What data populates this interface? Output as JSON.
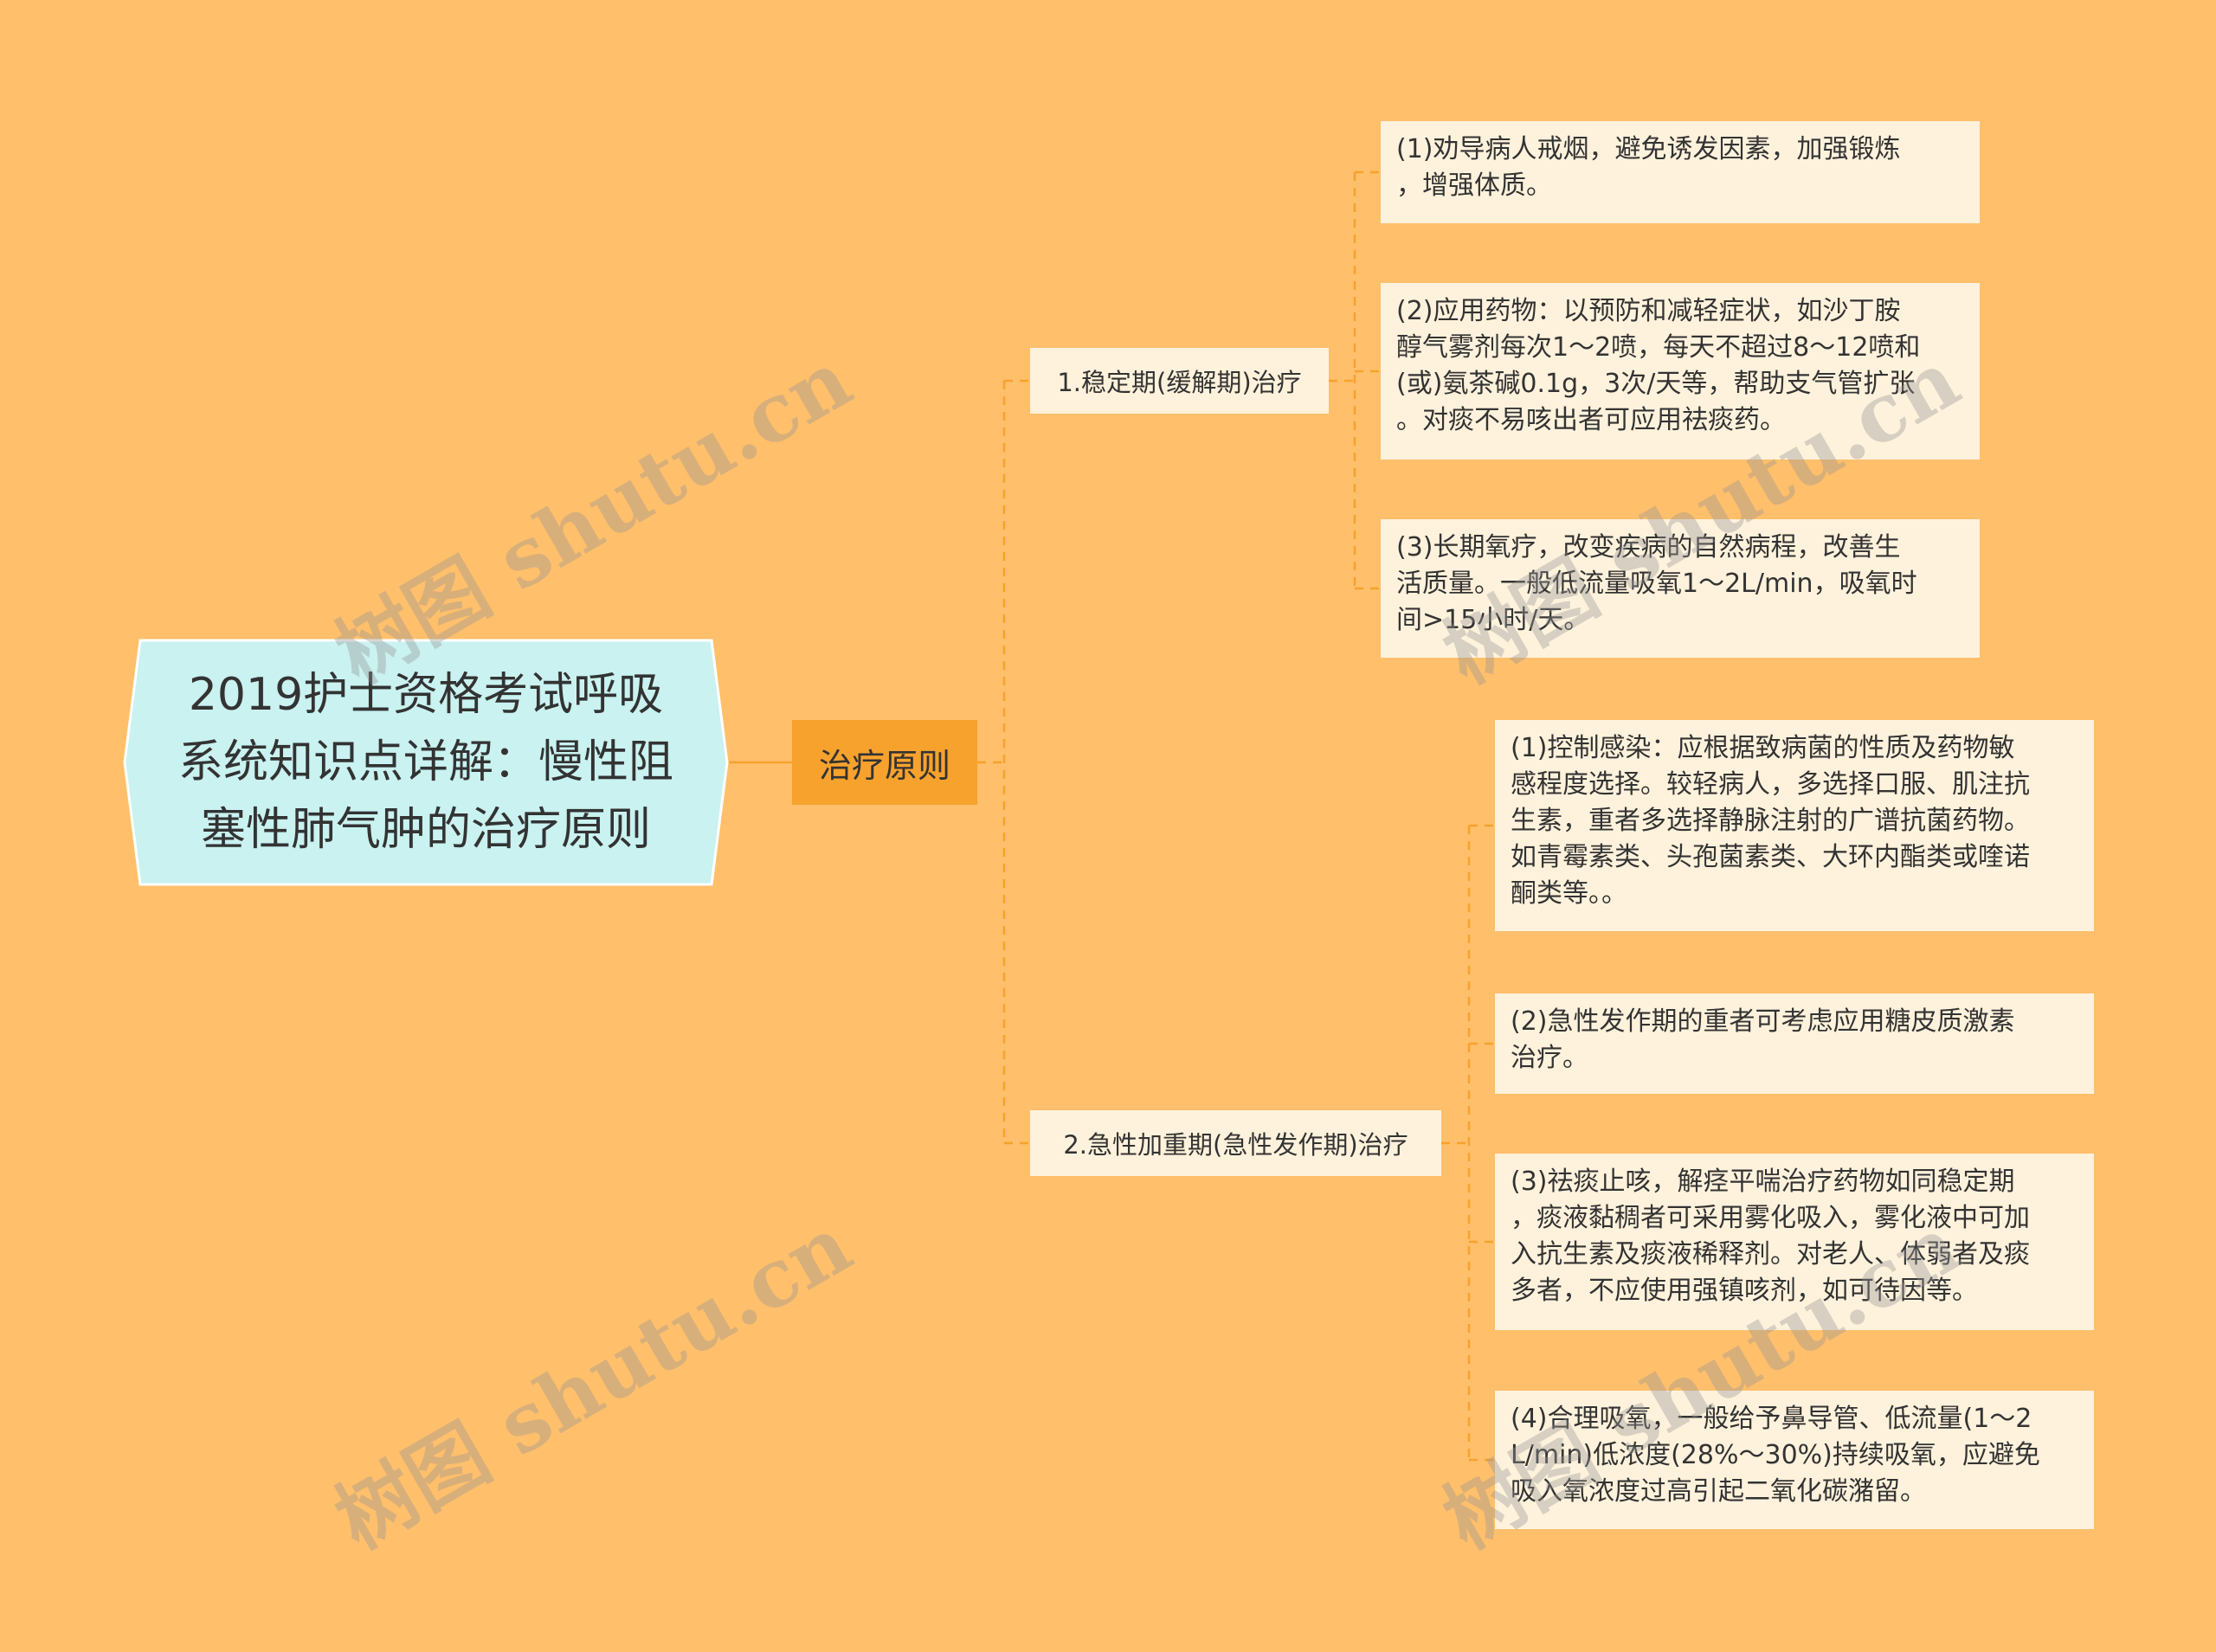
{
  "root": {
    "title": "2019护士资格考试呼吸系统知识点详解：慢性阻塞性肺气肿的治疗原则"
  },
  "hub": {
    "label": "治疗原则"
  },
  "branches": [
    {
      "label": "1.稳定期(缓解期)治疗",
      "items": [
        {
          "lines": [
            "(1)劝导病人戒烟，避免诱发因素，加强锻炼",
            "，增强体质。"
          ]
        },
        {
          "lines": [
            "(2)应用药物：以预防和减轻症状，如沙丁胺",
            "醇气雾剂每次1～2喷，每天不超过8～12喷和",
            "(或)氨茶碱0.1g，3次/天等，帮助支气管扩张",
            "。对痰不易咳出者可应用祛痰药。"
          ]
        },
        {
          "lines": [
            "(3)长期氧疗，改变疾病的自然病程，改善生",
            "活质量。一般低流量吸氧1～2L/min，吸氧时",
            "间>15小时/天。"
          ]
        }
      ]
    },
    {
      "label": "2.急性加重期(急性发作期)治疗",
      "items": [
        {
          "lines": [
            "(1)控制感染：应根据致病菌的性质及药物敏",
            "感程度选择。较轻病人，多选择口服、肌注抗",
            "生素，重者多选择静脉注射的广谱抗菌药物。",
            "如青霉素类、头孢菌素类、大环内酯类或喹诺",
            "酮类等。。"
          ]
        },
        {
          "lines": [
            "(2)急性发作期的重者可考虑应用糖皮质激素",
            "治疗。"
          ]
        },
        {
          "lines": [
            "(3)祛痰止咳，解痉平喘治疗药物如同稳定期",
            "，痰液黏稠者可采用雾化吸入，雾化液中可加",
            "入抗生素及痰液稀释剂。对老人、体弱者及痰",
            "多者，不应使用强镇咳剂，如可待因等。"
          ]
        },
        {
          "lines": [
            "(4)合理吸氧，一般给予鼻导管、低流量(1～2",
            "L/min)低浓度(28%～30%)持续吸氧，应避免",
            "吸入氧浓度过高引起二氧化碳潴留。"
          ]
        }
      ]
    }
  ],
  "watermark": {
    "text": "树图 shutu.cn"
  },
  "colors": {
    "background": "#ffbf6b",
    "root_fill": "#c9f2f0",
    "root_border": "#ffffff",
    "hub_fill": "#f7a22d",
    "node_fill": "#fff2dc",
    "connector": "#f7a22d"
  }
}
